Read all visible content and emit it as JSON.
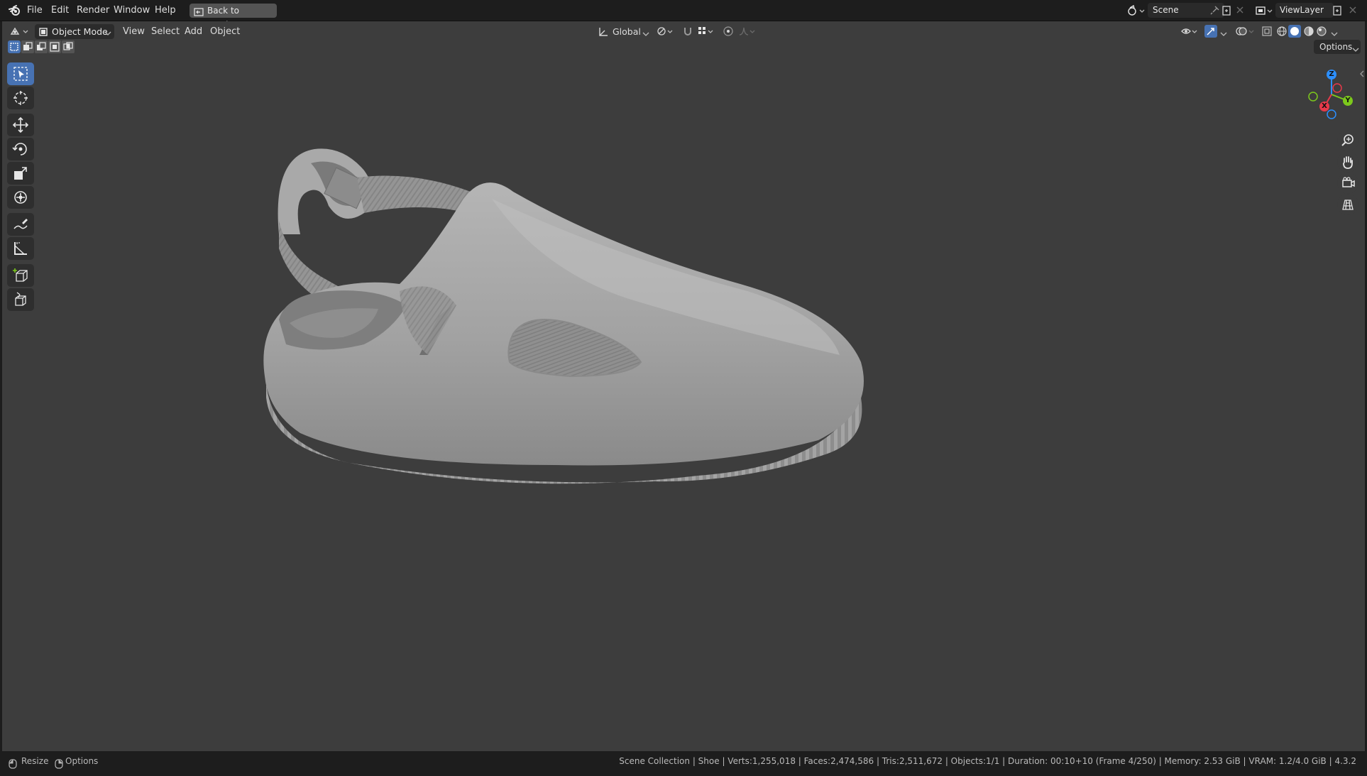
{
  "menu": {
    "file": "File",
    "edit": "Edit",
    "render": "Render",
    "window": "Window",
    "help": "Help",
    "back": "Back to Previous"
  },
  "scene": {
    "label": "Scene"
  },
  "view_layer": {
    "label": "ViewLayer"
  },
  "header": {
    "mode": "Object Mode",
    "view": "View",
    "select": "Select",
    "add": "Add",
    "object": "Object",
    "orientation": "Global",
    "options": "Options"
  },
  "gizmo": {
    "x": "X",
    "y": "Y",
    "z": "Z"
  },
  "status": {
    "left1": "Resize",
    "left2": "Options",
    "right": "Scene Collection | Shoe | Verts:1,255,018 | Faces:2,474,586 | Tris:2,511,672 | Objects:1/1 | Duration: 00:10+10 (Frame 4/250) | Memory: 2.53 GiB | VRAM: 1.2/4.0 GiB | 4.3.2"
  },
  "colors": {
    "accent": "#4772b3",
    "viewport_bg": "#3d3d3d",
    "axis_x": "#e8394a",
    "axis_y": "#7cc81c",
    "axis_z": "#2c8fff"
  },
  "icons": {
    "blender": "blender-logo-icon",
    "select": "select-box-icon",
    "cursor": "cursor-icon",
    "move": "move-icon",
    "rotate": "rotate-icon",
    "scale": "scale-icon",
    "transform": "transform-icon",
    "annotate": "annotate-icon",
    "measure": "measure-icon",
    "add_cube": "add-cube-icon",
    "extrude": "extrude-icon",
    "zoom": "zoom-icon",
    "pan": "hand-icon",
    "camera": "camera-icon",
    "ortho": "grid-icon"
  }
}
